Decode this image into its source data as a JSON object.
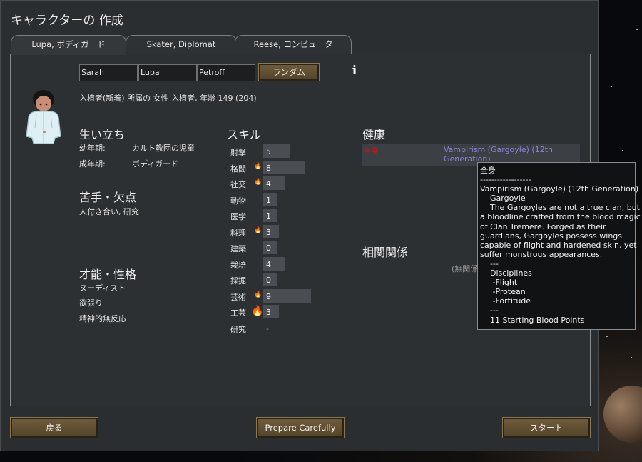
{
  "window": {
    "title": "キャラクターの 作成"
  },
  "tabs": [
    {
      "label": "Lupa, ボディガード",
      "active": true
    },
    {
      "label": "Skater, Diplomat",
      "active": false
    },
    {
      "label": "Reese, コンピュータ",
      "active": false
    }
  ],
  "name": {
    "first": "Sarah",
    "nick": "Lupa",
    "last": "Petroff",
    "randomize_label": "ランダム"
  },
  "pawn": {
    "description": "入植者(新着) 所属の 女性 入植者, 年齢 149 (204)"
  },
  "backstory": {
    "heading": "生い立ち",
    "childhood_label": "幼年期:",
    "childhood_value": "カルト教団の児童",
    "adulthood_label": "成年期:",
    "adulthood_value": "ボディガード"
  },
  "incapable": {
    "heading": "苦手・欠点",
    "value": "人付き合い, 研究"
  },
  "traits": {
    "heading": "才能・性格",
    "items": [
      "ヌーディスト",
      "欲張り",
      "精神的無反応"
    ]
  },
  "skills": {
    "heading": "スキル",
    "items": [
      {
        "name": "射撃",
        "level": "5",
        "passion": "none"
      },
      {
        "name": "格闘",
        "level": "8",
        "passion": "minor"
      },
      {
        "name": "社交",
        "level": "4",
        "passion": "minor"
      },
      {
        "name": "動物",
        "level": "1",
        "passion": "none"
      },
      {
        "name": "医学",
        "level": "1",
        "passion": "none"
      },
      {
        "name": "料理",
        "level": "3",
        "passion": "minor"
      },
      {
        "name": "建築",
        "level": "0",
        "passion": "none"
      },
      {
        "name": "栽培",
        "level": "4",
        "passion": "none"
      },
      {
        "name": "採掘",
        "level": "0",
        "passion": "none"
      },
      {
        "name": "芸術",
        "level": "9",
        "passion": "minor"
      },
      {
        "name": "工芸",
        "level": "3",
        "passion": "major"
      },
      {
        "name": "研究",
        "level": "-",
        "passion": "none"
      }
    ]
  },
  "health": {
    "heading": "健康",
    "rows": [
      {
        "part": "全身",
        "condition": "Vampirism (Gargoyle) (12th Generation)"
      }
    ]
  },
  "relations": {
    "heading": "相関関係",
    "empty_text": "(無関係"
  },
  "tooltip": {
    "lines": [
      "全身",
      "------------------",
      "Vampirism (Gargoyle) (12th Generation)",
      "    Gargoyle",
      "    The Gargoyles are not a true clan, but",
      "a bloodline crafted from the blood magic",
      "of Clan Tremere. Forged as their",
      "guardians, Gargoyles possess wings",
      "capable of flight and hardened skin, yet",
      "suffer monstrous appearances.",
      "    ---",
      "    Disciplines",
      "     -Flight",
      "     -Protean",
      "     -Fortitude",
      "    ---",
      "    11 Starting Blood Points"
    ]
  },
  "buttons": {
    "back": "戻る",
    "prepare": "Prepare Carefully",
    "start": "スタート"
  },
  "colors": {
    "button": "#5f4e33",
    "panel": "#2d3033",
    "health_part": "#c21818",
    "health_condition": "#8e84d6",
    "passion": "#f0a020"
  }
}
